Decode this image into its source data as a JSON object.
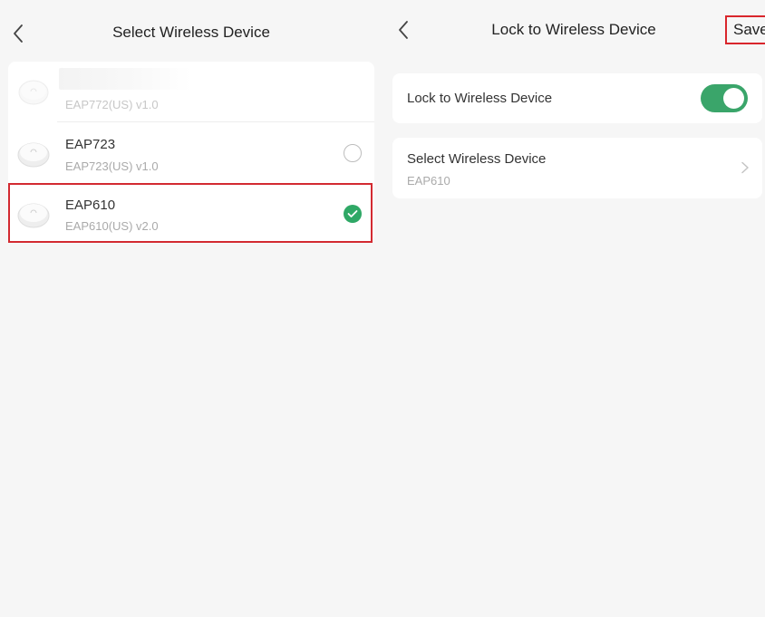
{
  "left_screen": {
    "title": "Select Wireless Device",
    "icons": {
      "back": "chevron-left-icon",
      "device": "access-point-icon",
      "checked": "check-circle-icon"
    },
    "devices": [
      {
        "name": "",
        "model": "EAP772(US) v1.0",
        "selected": false
      },
      {
        "name": "EAP723",
        "model": "EAP723(US) v1.0",
        "selected": false
      },
      {
        "name": "EAP610",
        "model": "EAP610(US) v2.0",
        "selected": true
      }
    ]
  },
  "right_screen": {
    "title": "Lock to Wireless Device",
    "save_label": "Save",
    "lock_toggle": {
      "label": "Lock to Wireless Device",
      "enabled": true
    },
    "select_device": {
      "label": "Select Wireless Device",
      "value": "EAP610"
    },
    "icons": {
      "back": "chevron-left-icon",
      "next": "chevron-right-icon"
    }
  },
  "colors": {
    "accent_green": "#2fa866",
    "highlight_red": "#d32a31",
    "background": "#f6f6f6"
  }
}
